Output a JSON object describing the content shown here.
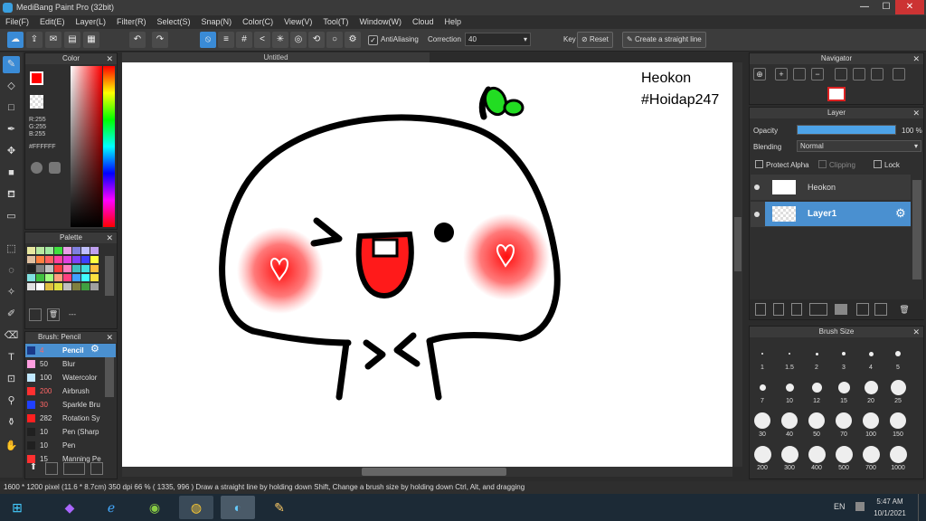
{
  "window": {
    "title": "MediBang Paint Pro (32bit)",
    "minimize": "—",
    "maximize": "☐",
    "close": "✕"
  },
  "menu": [
    "File(F)",
    "Edit(E)",
    "Layer(L)",
    "Filter(R)",
    "Select(S)",
    "Snap(N)",
    "Color(C)",
    "View(V)",
    "Tool(T)",
    "Window(W)",
    "Cloud",
    "Help"
  ],
  "toolbar": {
    "antialiasing_label": "AntiAliasing",
    "correction_label": "Correction",
    "correction_value": "40",
    "key_label": "Key",
    "reset_label": "Reset",
    "straight_line_label": "Create a straight line"
  },
  "color_panel": {
    "title": "Color",
    "rgb": [
      "R:255",
      "G:255",
      "B:255"
    ],
    "hex": "#FFFFFF"
  },
  "palette_panel": {
    "title": "Palette",
    "dash": "---",
    "colors": [
      "#e8e8a0",
      "#b8e8a0",
      "#a0e8a0",
      "#40e040",
      "#e8a0e8",
      "#8080e0",
      "#c0c0ff",
      "#c0a0f0",
      "#e0c0a0",
      "#ff8040",
      "#ff6060",
      "#ff40a0",
      "#e040e0",
      "#8040ff",
      "#4040ff",
      "#ffff40",
      "#202020",
      "#808080",
      "#c0c0c0",
      "#ff4040",
      "#ff80c0",
      "#40c0c0",
      "#40e0e0",
      "#ffc040",
      "#80e0e0",
      "#40c040",
      "#a0ff80",
      "#ffa080",
      "#ff4080",
      "#40a0ff",
      "#40ffff",
      "#ffe040",
      "#e0e0e0",
      "#ffffff",
      "#e0c040",
      "#e0e040",
      "#c0c0c0",
      "#808040",
      "#40a040",
      "#a0a0a0"
    ]
  },
  "brush_panel": {
    "title": "Brush: Pencil",
    "items": [
      {
        "size": "4",
        "name": "Pencil",
        "color": "#1a3a8a"
      },
      {
        "size": "50",
        "name": "Blur",
        "color": "#ff9ee0"
      },
      {
        "size": "100",
        "name": "Watercolor",
        "color": "#c0e8ff"
      },
      {
        "size": "200",
        "name": "Airbrush",
        "color": "#ff3030"
      },
      {
        "size": "30",
        "name": "Sparkle Bru",
        "color": "#2040ff"
      },
      {
        "size": "282",
        "name": "Rotation Sy",
        "color": "#ff2020"
      },
      {
        "size": "10",
        "name": "Pen (Sharp",
        "color": "#202020"
      },
      {
        "size": "10",
        "name": "Pen",
        "color": "#202020"
      },
      {
        "size": "15",
        "name": "Manning Pe",
        "color": "#ff3030"
      }
    ]
  },
  "document": {
    "tab": "Untitled",
    "watermark": [
      "Heokon",
      "#Hoidap247"
    ]
  },
  "navigator": {
    "title": "Navigator"
  },
  "layer_panel": {
    "title": "Layer",
    "opacity_label": "Opacity",
    "opacity_value": "100 %",
    "opacity_level": 1.0,
    "blending_label": "Blending",
    "blending_value": "Normal",
    "protect_alpha": "Protect Alpha",
    "clipping": "Clipping",
    "lock": "Lock",
    "layers": [
      {
        "name": "Heokon",
        "selected": false
      },
      {
        "name": "Layer1",
        "selected": true
      }
    ]
  },
  "brush_size_panel": {
    "title": "Brush Size",
    "sizes": [
      "1",
      "1.5",
      "2",
      "3",
      "4",
      "5",
      "7",
      "10",
      "12",
      "15",
      "20",
      "25",
      "30",
      "40",
      "50",
      "70",
      "100",
      "150",
      "200",
      "300",
      "400",
      "500",
      "700",
      "1000"
    ]
  },
  "status": {
    "text": "1600 * 1200 pixel   (11.6 * 8.7cm)   350 dpi   66 %   ( 1335, 996 )   Draw a straight line by holding down Shift, Change a brush size by holding down Ctrl, Alt, and dragging"
  },
  "taskbar": {
    "lang": "EN",
    "time": "5:47 AM",
    "date": "10/1/2021"
  }
}
